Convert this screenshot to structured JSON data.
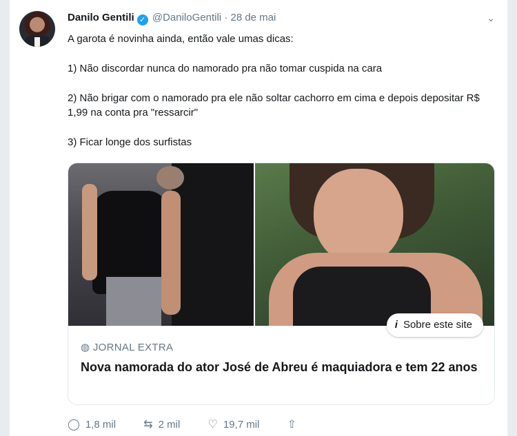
{
  "tweet": {
    "display_name": "Danilo Gentili",
    "handle": "@DaniloGentili",
    "date": "· 28 de mai",
    "lines": [
      "A garota é novinha ainda, então vale umas dicas:",
      "1) Não discordar nunca do namorado pra não tomar cuspida na cara",
      "2) Não brigar com o namorado pra ele não soltar cachorro em cima e depois depositar R$ 1,99 na conta pra \"ressarcir\"",
      "3) Ficar longe dos surfistas"
    ]
  },
  "card": {
    "about_label": "Sobre este site",
    "source": "JORNAL EXTRA",
    "title": "Nova namorada do ator José de Abreu é maquiadora e tem 22 anos"
  },
  "actions": {
    "replies": "1,8 mil",
    "retweets": "2 mil",
    "likes": "19,7 mil"
  },
  "icons": [
    "verified-badge-icon",
    "chevron-down-icon",
    "info-icon",
    "globe-icon",
    "reply-icon",
    "retweet-icon",
    "like-icon",
    "share-icon"
  ],
  "colors": {
    "accent": "#1da1f2",
    "muted": "#657786",
    "text": "#14171a"
  }
}
